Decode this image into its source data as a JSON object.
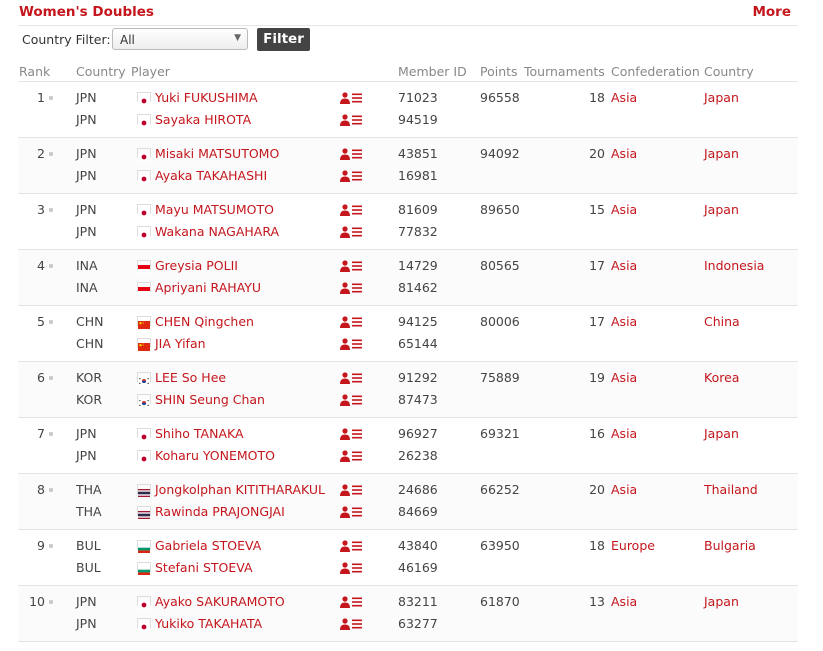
{
  "header": {
    "title": "Women's Doubles",
    "more": "More"
  },
  "filter": {
    "label": "Country Filter:",
    "selected": "All",
    "button": "Filter"
  },
  "columns": {
    "rank": "Rank",
    "country": "Country",
    "player": "Player",
    "member_id": "Member ID",
    "points": "Points",
    "tournaments": "Tournaments",
    "confederation": "Confederation",
    "country2": "Country"
  },
  "colors": {
    "accent": "#c4161c"
  },
  "rows": [
    {
      "rank": "1",
      "points": "96558",
      "tournaments": "18",
      "confederation": "Asia",
      "country": "Japan",
      "players": [
        {
          "code": "JPN",
          "flag": "jpn",
          "name": "Yuki FUKUSHIMA",
          "member_id": "71023"
        },
        {
          "code": "JPN",
          "flag": "jpn",
          "name": "Sayaka HIROTA",
          "member_id": "94519"
        }
      ]
    },
    {
      "rank": "2",
      "points": "94092",
      "tournaments": "20",
      "confederation": "Asia",
      "country": "Japan",
      "players": [
        {
          "code": "JPN",
          "flag": "jpn",
          "name": "Misaki MATSUTOMO",
          "member_id": "43851"
        },
        {
          "code": "JPN",
          "flag": "jpn",
          "name": "Ayaka TAKAHASHI",
          "member_id": "16981"
        }
      ]
    },
    {
      "rank": "3",
      "points": "89650",
      "tournaments": "15",
      "confederation": "Asia",
      "country": "Japan",
      "players": [
        {
          "code": "JPN",
          "flag": "jpn",
          "name": "Mayu MATSUMOTO",
          "member_id": "81609"
        },
        {
          "code": "JPN",
          "flag": "jpn",
          "name": "Wakana NAGAHARA",
          "member_id": "77832"
        }
      ]
    },
    {
      "rank": "4",
      "points": "80565",
      "tournaments": "17",
      "confederation": "Asia",
      "country": "Indonesia",
      "players": [
        {
          "code": "INA",
          "flag": "ina",
          "name": "Greysia POLII",
          "member_id": "14729"
        },
        {
          "code": "INA",
          "flag": "ina",
          "name": "Apriyani RAHAYU",
          "member_id": "81462"
        }
      ]
    },
    {
      "rank": "5",
      "points": "80006",
      "tournaments": "17",
      "confederation": "Asia",
      "country": "China",
      "players": [
        {
          "code": "CHN",
          "flag": "chn",
          "name": "CHEN Qingchen",
          "member_id": "94125"
        },
        {
          "code": "CHN",
          "flag": "chn",
          "name": "JIA Yifan",
          "member_id": "65144"
        }
      ]
    },
    {
      "rank": "6",
      "points": "75889",
      "tournaments": "19",
      "confederation": "Asia",
      "country": "Korea",
      "players": [
        {
          "code": "KOR",
          "flag": "kor",
          "name": "LEE So Hee",
          "member_id": "91292"
        },
        {
          "code": "KOR",
          "flag": "kor",
          "name": "SHIN Seung Chan",
          "member_id": "87473"
        }
      ]
    },
    {
      "rank": "7",
      "points": "69321",
      "tournaments": "16",
      "confederation": "Asia",
      "country": "Japan",
      "players": [
        {
          "code": "JPN",
          "flag": "jpn",
          "name": "Shiho TANAKA",
          "member_id": "96927"
        },
        {
          "code": "JPN",
          "flag": "jpn",
          "name": "Koharu YONEMOTO",
          "member_id": "26238"
        }
      ]
    },
    {
      "rank": "8",
      "points": "66252",
      "tournaments": "20",
      "confederation": "Asia",
      "country": "Thailand",
      "players": [
        {
          "code": "THA",
          "flag": "tha",
          "name": "Jongkolphan KITITHARAKUL",
          "member_id": "24686"
        },
        {
          "code": "THA",
          "flag": "tha",
          "name": "Rawinda PRAJONGJAI",
          "member_id": "84669"
        }
      ]
    },
    {
      "rank": "9",
      "points": "63950",
      "tournaments": "18",
      "confederation": "Europe",
      "country": "Bulgaria",
      "players": [
        {
          "code": "BUL",
          "flag": "bul",
          "name": "Gabriela STOEVA",
          "member_id": "43840"
        },
        {
          "code": "BUL",
          "flag": "bul",
          "name": "Stefani STOEVA",
          "member_id": "46169"
        }
      ]
    },
    {
      "rank": "10",
      "points": "61870",
      "tournaments": "13",
      "confederation": "Asia",
      "country": "Japan",
      "players": [
        {
          "code": "JPN",
          "flag": "jpn",
          "name": "Ayako SAKURAMOTO",
          "member_id": "83211"
        },
        {
          "code": "JPN",
          "flag": "jpn",
          "name": "Yukiko TAKAHATA",
          "member_id": "63277"
        }
      ]
    }
  ]
}
